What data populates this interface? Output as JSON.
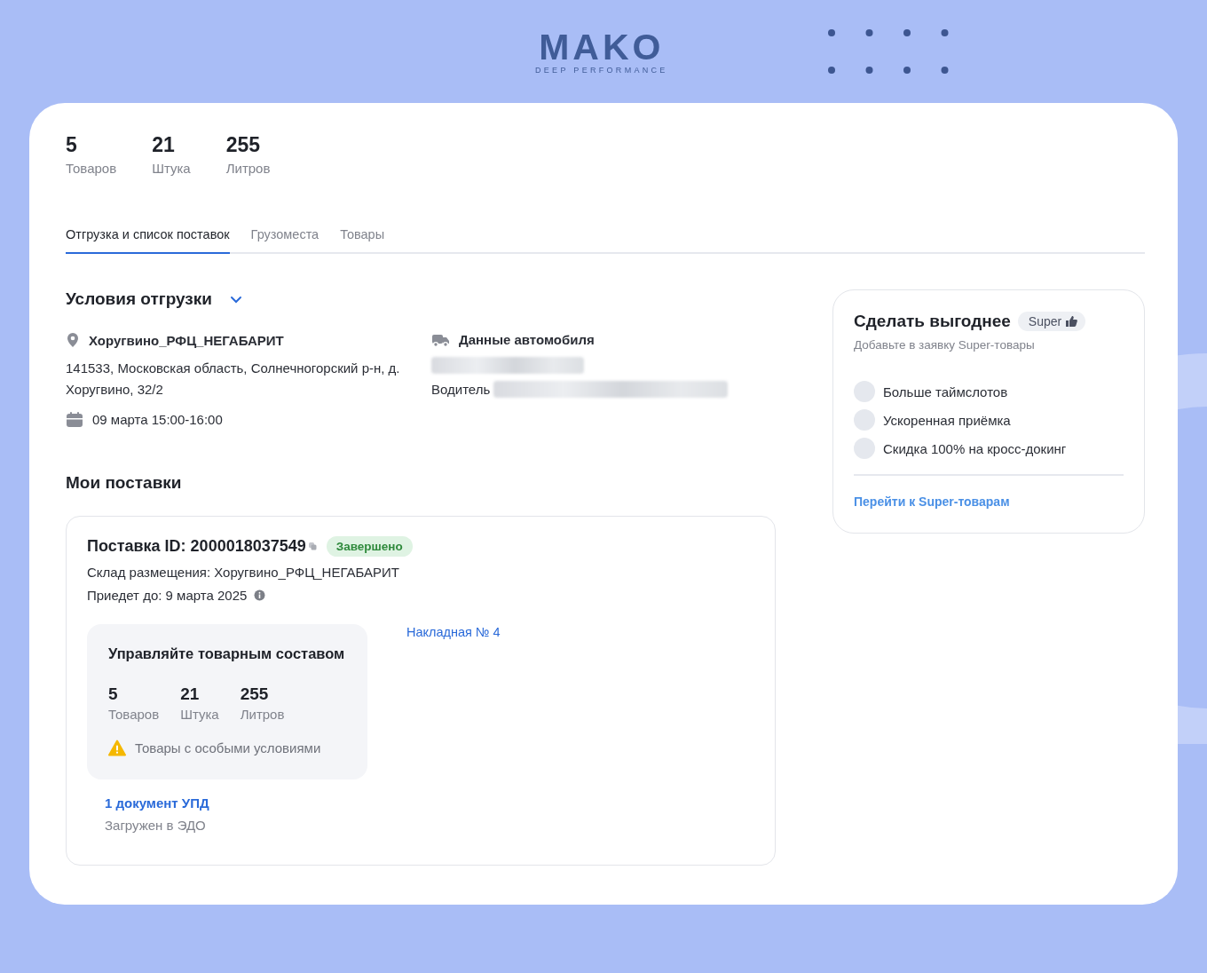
{
  "logo": {
    "title": "MAKO",
    "tagline": "DEEP PERFORMANCE"
  },
  "summary": [
    {
      "value": "5",
      "label": "Товаров"
    },
    {
      "value": "21",
      "label": "Штука"
    },
    {
      "value": "255",
      "label": "Литров"
    }
  ],
  "tabs": [
    {
      "label": "Отгрузка и список поставок",
      "selected": true
    },
    {
      "label": "Грузоместа",
      "selected": false
    },
    {
      "label": "Товары",
      "selected": false
    }
  ],
  "shipping_conditions": {
    "title": "Условия отгрузки",
    "expanded": true,
    "warehouse": "Хоругвино_РФЦ_НЕГАБАРИТ",
    "address": "141533, Московская область, Солнечногорский р-н, д. Хоругвино, 32/2",
    "slot": "09 марта 15:00-16:00",
    "vehicle": {
      "title": "Данные автомобиля",
      "driver_label": "Водитель"
    }
  },
  "my_deliveries": {
    "title": "Мои поставки",
    "delivery": {
      "id_label": "Поставка ID: 2000018037549",
      "status": "Завершено",
      "warehouse": "Склад размещения: Хоругвино_РФЦ_НЕГАБАРИТ",
      "arrival": "Приедет до: 9 марта 2025",
      "invoice_link": "Накладная № 4",
      "manage": {
        "title": "Управляйте товарным составом",
        "stats": [
          {
            "value": "5",
            "label": "Товаров"
          },
          {
            "value": "21",
            "label": "Штука"
          },
          {
            "value": "255",
            "label": "Литров"
          }
        ],
        "warning": "Товары с особыми условиями"
      },
      "document_link": "1 документ УПД",
      "document_status": "Загружен в ЭДО"
    }
  },
  "promo": {
    "title": "Сделать выгоднее",
    "badge": "Super",
    "subtitle": "Добавьте в заявку Super-товары",
    "items": [
      "Больше таймслотов",
      "Ускоренная приёмка",
      "Скидка 100% на кросс-докинг"
    ],
    "link": "Перейти к Super-товарам"
  }
}
